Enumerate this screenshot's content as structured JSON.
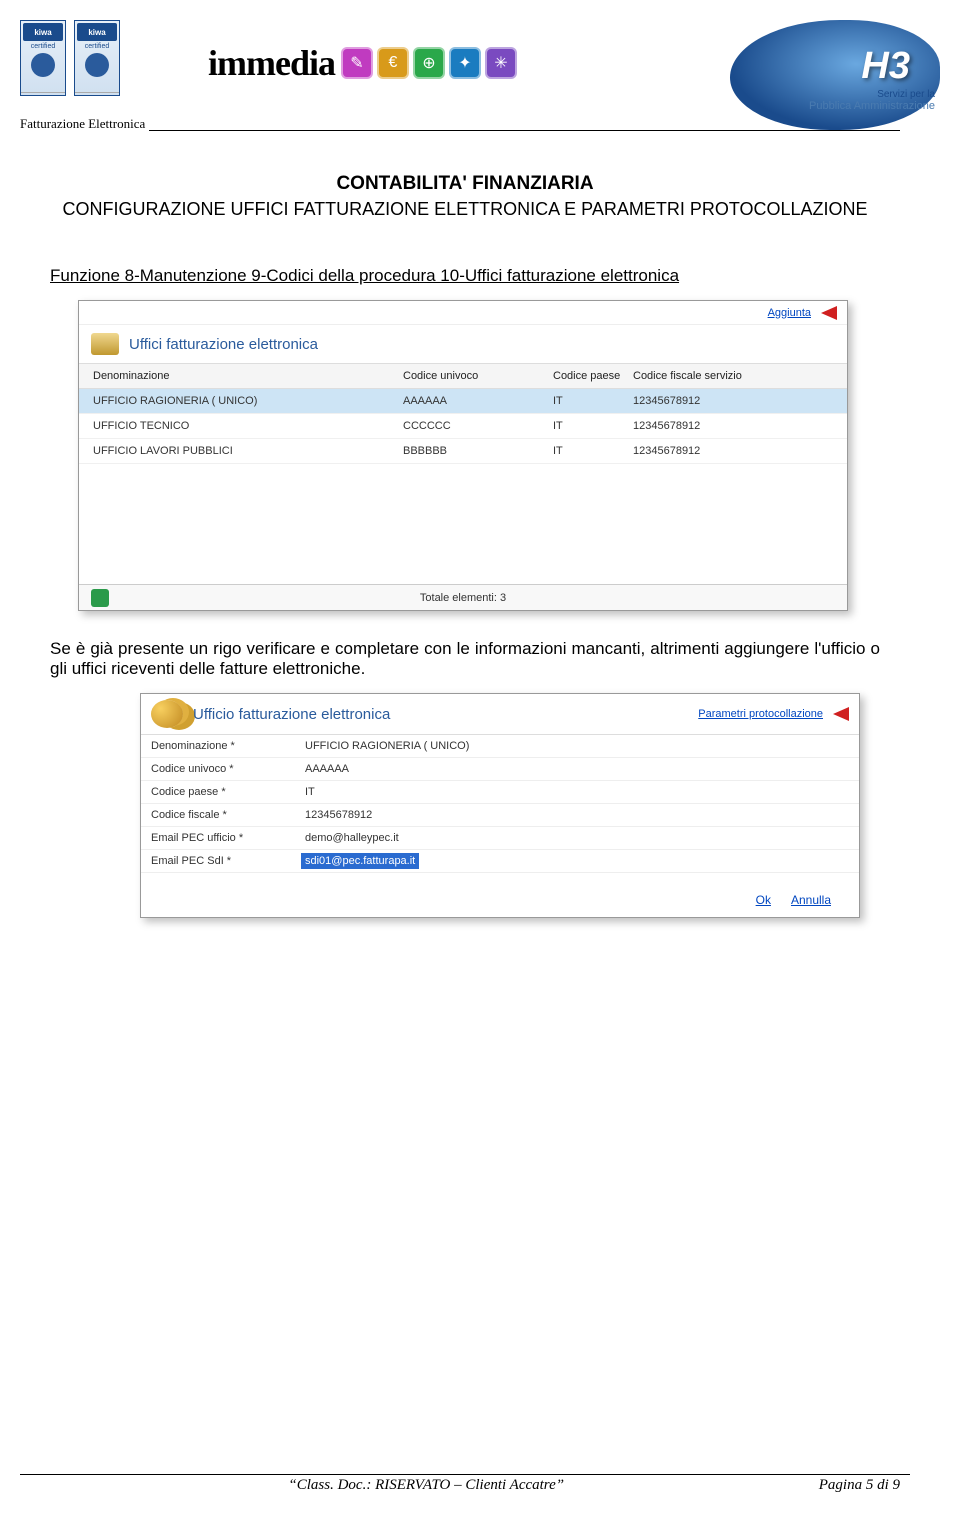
{
  "header": {
    "kiwa_brand": "kiwa",
    "kiwa_cert": "certified",
    "brand": "immedia",
    "h3_mark": "H3",
    "h3_line1": "Servizi per la",
    "h3_line2": "Pubblica Amministrazione",
    "topic": "Fatturazione Elettronica"
  },
  "body": {
    "title1": "CONTABILITA' FINANZIARIA",
    "title2": "CONFIGURAZIONE UFFICI FATTURAZIONE ELETTRONICA E PARAMETRI PROTOCOLLAZIONE",
    "path": "Funzione 8-Manutenzione 9-Codici della procedura 10-Uffici fatturazione elettronica",
    "para": "Se è già presente un rigo verificare e completare con le informazioni mancanti, altrimenti aggiungere l'ufficio o gli uffici riceventi delle fatture elettroniche."
  },
  "shot1": {
    "add_link": "Aggiunta",
    "title": "Uffici fatturazione elettronica",
    "columns": {
      "c1": "Denominazione",
      "c2": "Codice univoco",
      "c3": "Codice paese",
      "c4": "Codice fiscale servizio"
    },
    "rows": [
      {
        "denom": "UFFICIO RAGIONERIA ( UNICO)",
        "cod": "AAAAAA",
        "paese": "IT",
        "cf": "12345678912"
      },
      {
        "denom": "UFFICIO TECNICO",
        "cod": "CCCCCC",
        "paese": "IT",
        "cf": "12345678912"
      },
      {
        "denom": "UFFICIO LAVORI PUBBLICI",
        "cod": "BBBBBB",
        "paese": "IT",
        "cf": "12345678912"
      }
    ],
    "footer": "Totale elementi: 3"
  },
  "shot2": {
    "title": "Ufficio fatturazione elettronica",
    "top_link": "Parametri protocollazione",
    "fields": {
      "denom_lbl": "Denominazione",
      "denom_val": "UFFICIO RAGIONERIA ( UNICO)",
      "cod_lbl": "Codice univoco",
      "cod_val": "AAAAAA",
      "paese_lbl": "Codice paese",
      "paese_val": "IT",
      "cf_lbl": "Codice fiscale",
      "cf_val": "12345678912",
      "pecu_lbl": "Email PEC ufficio",
      "pecu_val": "demo@halleypec.it",
      "pecs_lbl": "Email PEC SdI",
      "pecs_val": "sdi01@pec.fatturapa.it"
    },
    "ok": "Ok",
    "cancel": "Annulla"
  },
  "footer": {
    "left": "“Class. Doc.: RISERVATO – Clienti Accatre”",
    "right": "Pagina 5 di 9"
  }
}
